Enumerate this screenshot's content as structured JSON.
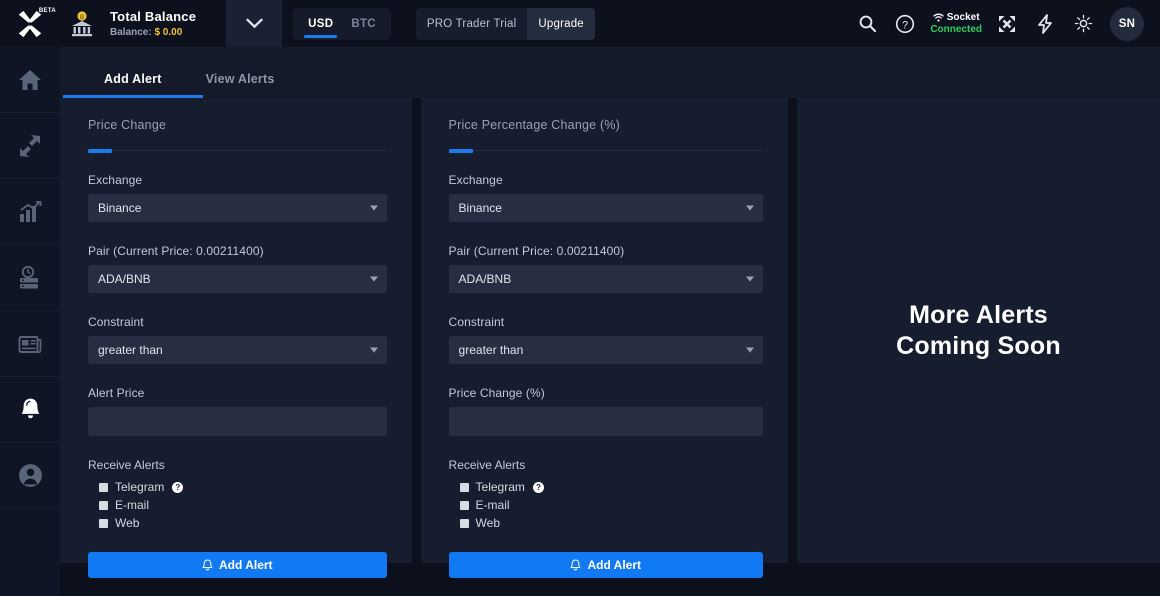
{
  "header": {
    "logo_name": "x-star-logo",
    "beta_badge": "BETA",
    "bank_icon": "bank-coin-icon",
    "balance_title": "Total Balance",
    "balance_prefix": "Balance:",
    "balance_amount": "$ 0.00",
    "currency": {
      "options": [
        "USD",
        "BTC"
      ],
      "selected": "USD"
    },
    "pro": {
      "label": "PRO Trader Trial",
      "upgrade": "Upgrade"
    },
    "socket": {
      "label": "Socket",
      "status": "Connected"
    },
    "avatar_initials": "SN",
    "icons": [
      "search-icon",
      "help-icon",
      "fullscreen-icon",
      "lightning-icon",
      "brightness-icon"
    ]
  },
  "sidebar": {
    "items": [
      {
        "name": "home",
        "active": false
      },
      {
        "name": "exchange",
        "active": false
      },
      {
        "name": "charts",
        "active": false
      },
      {
        "name": "history",
        "active": false
      },
      {
        "name": "news",
        "active": false
      },
      {
        "name": "alerts",
        "active": true
      },
      {
        "name": "account",
        "active": false
      }
    ]
  },
  "tabs": [
    {
      "label": "Add Alert",
      "active": true
    },
    {
      "label": "View Alerts",
      "active": false
    }
  ],
  "cards": {
    "price_change": {
      "title": "Price Change",
      "exchange_label": "Exchange",
      "exchange_value": "Binance",
      "pair_label": "Pair (Current Price: 0.00211400)",
      "pair_value": "ADA/BNB",
      "constraint_label": "Constraint",
      "constraint_value": "greater than",
      "value_label": "Alert Price",
      "value_input": "",
      "receive_label": "Receive Alerts",
      "channels": [
        "Telegram",
        "E-mail",
        "Web"
      ],
      "help_glyph": "?",
      "submit_label": "Add Alert"
    },
    "price_percentage_change": {
      "title": "Price Percentage Change (%)",
      "exchange_label": "Exchange",
      "exchange_value": "Binance",
      "pair_label": "Pair (Current Price: 0.00211400)",
      "pair_value": "ADA/BNB",
      "constraint_label": "Constraint",
      "constraint_value": "greater than",
      "value_label": "Price Change (%)",
      "value_input": "",
      "receive_label": "Receive Alerts",
      "channels": [
        "Telegram",
        "E-mail",
        "Web"
      ],
      "help_glyph": "?",
      "submit_label": "Add Alert"
    },
    "coming_soon": {
      "line1": "More Alerts",
      "line2": "Coming Soon"
    }
  },
  "colors": {
    "accent_blue": "#1c7ced",
    "button_blue": "#1279f4",
    "status_green": "#2fcf5f",
    "balance_gold": "#f0c23a",
    "page_bg": "#0c101c",
    "panel_bg": "#161d2e",
    "field_bg": "#272e42"
  }
}
